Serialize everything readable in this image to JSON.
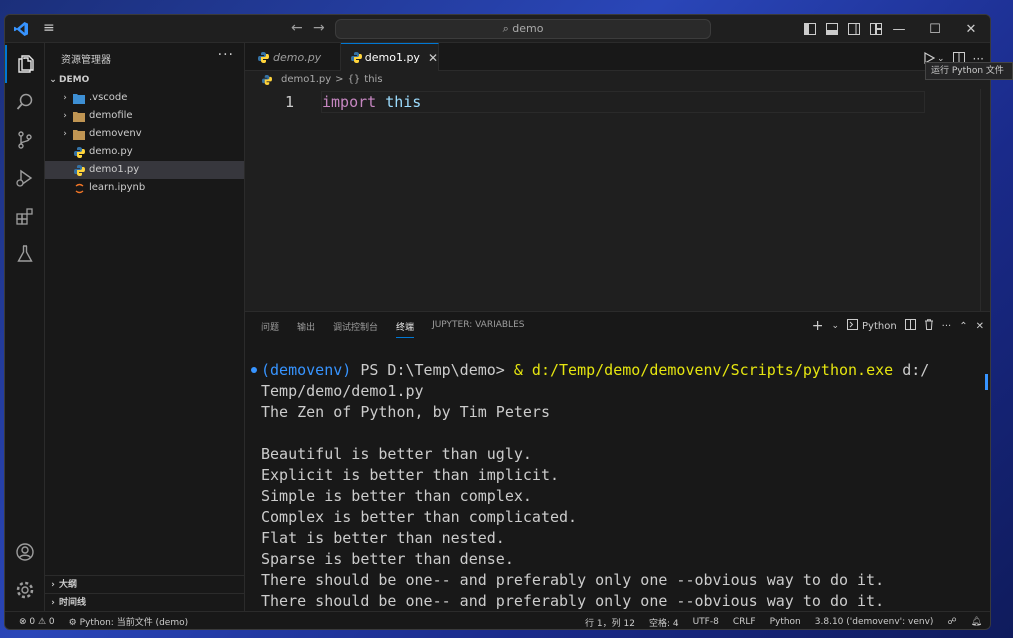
{
  "titlebar": {
    "search_text": "demo",
    "nav_back": "←",
    "nav_forward": "→"
  },
  "sidebar": {
    "title": "资源管理器",
    "more": "···",
    "root": "DEMO",
    "items": [
      {
        "label": ".vscode",
        "kind": "folder-vscode"
      },
      {
        "label": "demofile",
        "kind": "folder"
      },
      {
        "label": "demovenv",
        "kind": "folder"
      },
      {
        "label": "demo.py",
        "kind": "python"
      },
      {
        "label": "demo1.py",
        "kind": "python"
      },
      {
        "label": "learn.ipynb",
        "kind": "notebook"
      }
    ],
    "outline": "大纲",
    "timeline": "时间线"
  },
  "tabs": [
    {
      "label": "demo.py"
    },
    {
      "label": "demo1.py"
    }
  ],
  "breadcrumb": {
    "file": "demo1.py",
    "separator": ">",
    "symbol_icon": "{}",
    "symbol": "this"
  },
  "editor": {
    "line_number": "1",
    "keyword": "import",
    "identifier": "this"
  },
  "tooltip": "运行 Python 文件",
  "panel": {
    "tabs": [
      "问题",
      "输出",
      "调试控制台",
      "终端",
      "JUPYTER: VARIABLES"
    ],
    "active_tab": "终端",
    "terminal_profile": "Python",
    "add": "+",
    "more": "···"
  },
  "terminal": {
    "prompt_env": "(demovenv)",
    "prompt_path": " PS D:\\Temp\\demo> ",
    "amp": "&",
    "exe_path": " d:/Temp/demo/demovenv/Scripts/python.exe",
    "arg_line1": " d:/",
    "arg_line2": "Temp/demo/demo1.py",
    "lines": [
      "The Zen of Python, by Tim Peters",
      "",
      "Beautiful is better than ugly.",
      "Explicit is better than implicit.",
      "Simple is better than complex.",
      "Complex is better than complicated.",
      "Flat is better than nested.",
      "Sparse is better than dense.",
      "There should be one-- and preferably only one --obvious way to do it.",
      "There should be one-- and preferably only one --obvious way to do it."
    ]
  },
  "status": {
    "problems": "⊗ 0 ⚠ 0",
    "run_label": "Python: 当前文件 (demo)",
    "position": "行 1，列 12",
    "spaces": "空格: 4",
    "encoding": "UTF-8",
    "eol": "CRLF",
    "language": "Python",
    "interpreter": "3.8.10 ('demovenv': venv)"
  },
  "colors": {
    "accent": "#0078d4",
    "keyword": "#c586c0",
    "variable": "#9cdcfe",
    "venv": "#3794ff",
    "exe": "#e5e510"
  }
}
